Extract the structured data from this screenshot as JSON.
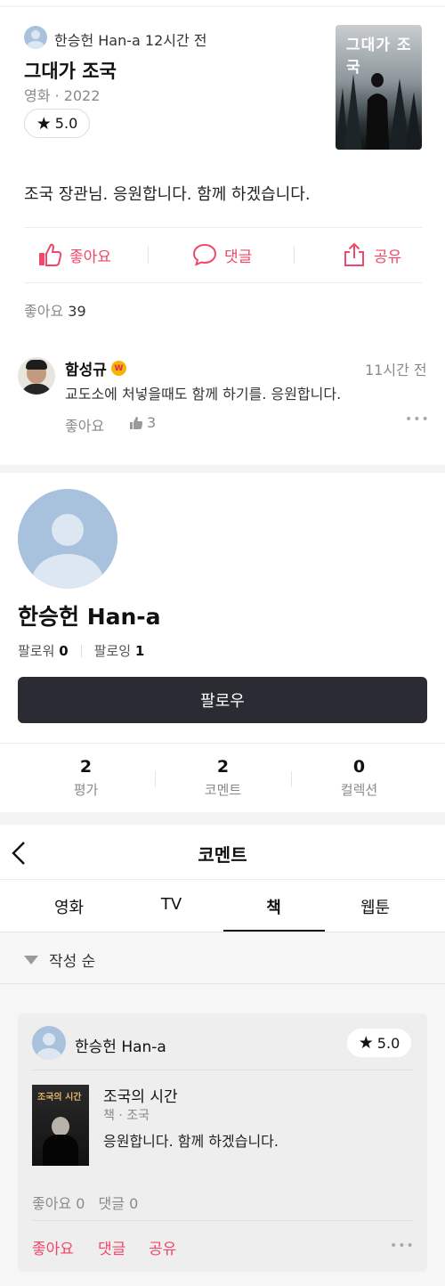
{
  "post": {
    "author": "한승헌 Han-a",
    "time": "12시간 전",
    "title": "그대가 조국",
    "meta": "영화 · 2022",
    "rating": "5.0",
    "poster_text": "그대가 조국",
    "body": "조국 장관님. 응원합니다. 함께 하겠습니다.",
    "actions": {
      "like": "좋아요",
      "comment": "댓글",
      "share": "공유"
    },
    "likes_label": "좋아요",
    "likes_count": "39"
  },
  "reply": {
    "author": "함성규",
    "badge": "W",
    "time": "11시간 전",
    "text": "교도소에 처넣을때도 함께 하기를. 응원합니다.",
    "like_label": "좋아요",
    "like_count": "3",
    "more": "•••"
  },
  "profile": {
    "name": "한승헌 Han-a",
    "followers_label": "팔로워",
    "followers": "0",
    "following_label": "팔로잉",
    "following": "1",
    "follow_button": "팔로우",
    "stats": [
      {
        "value": "2",
        "label": "평가"
      },
      {
        "value": "2",
        "label": "코멘트"
      },
      {
        "value": "0",
        "label": "컬렉션"
      }
    ]
  },
  "comments_page": {
    "title": "코멘트",
    "tabs": [
      "영화",
      "TV",
      "책",
      "웹툰"
    ],
    "active_tab": "책",
    "sort_label": "작성 순",
    "card": {
      "author": "한승헌 Han-a",
      "rating": "5.0",
      "book_title": "조국의 시간",
      "book_meta": "책 · 조국",
      "book_cover_text": "조국의 시간",
      "text": "응원합니다. 함께 하겠습니다.",
      "likes_label": "좋아요",
      "likes": "0",
      "comments_label": "댓글",
      "comments": "0",
      "actions": {
        "like": "좋아요",
        "comment": "댓글",
        "share": "공유"
      },
      "more": "•••"
    }
  },
  "colors": {
    "accent": "#f0476a",
    "dark_button": "#2b2c33",
    "avatar": "#a8c2dd"
  }
}
